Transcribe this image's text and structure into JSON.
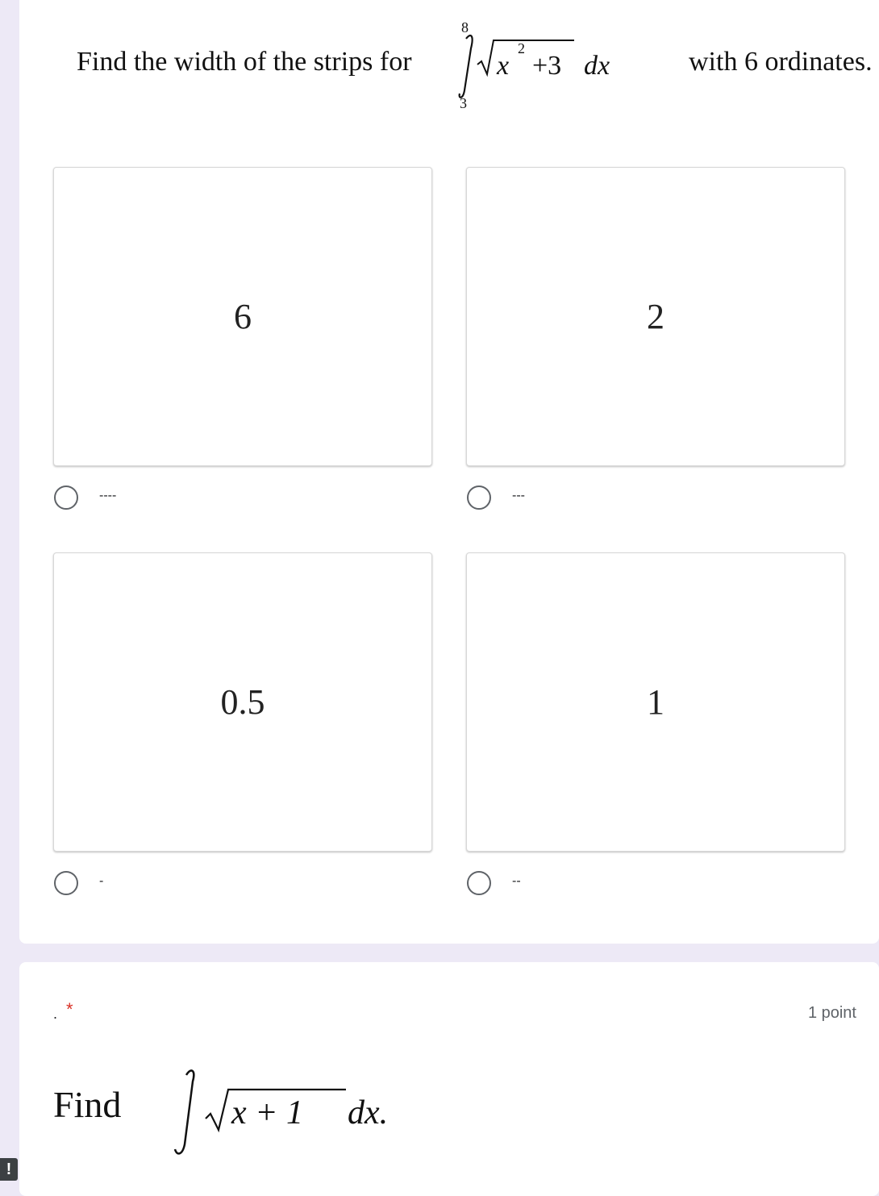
{
  "question1": {
    "prefix": "Find the width of the strips for",
    "integral": {
      "upper": "8",
      "lower": "3",
      "integrand_base": "x",
      "integrand_exponent": "2",
      "integrand_tail": "+3",
      "differential": "dx"
    },
    "suffix": "with 6 ordinates.",
    "options": [
      {
        "value": "6",
        "label": "----"
      },
      {
        "value": "2",
        "label": "---"
      },
      {
        "value": "0.5",
        "label": "-"
      },
      {
        "value": "1",
        "label": "--"
      }
    ]
  },
  "question2": {
    "title": ".",
    "required_mark": "*",
    "points": "1 point",
    "prompt_word": "Find",
    "integrand": "x + 1",
    "differential": "dx."
  },
  "side_indicator": "!"
}
